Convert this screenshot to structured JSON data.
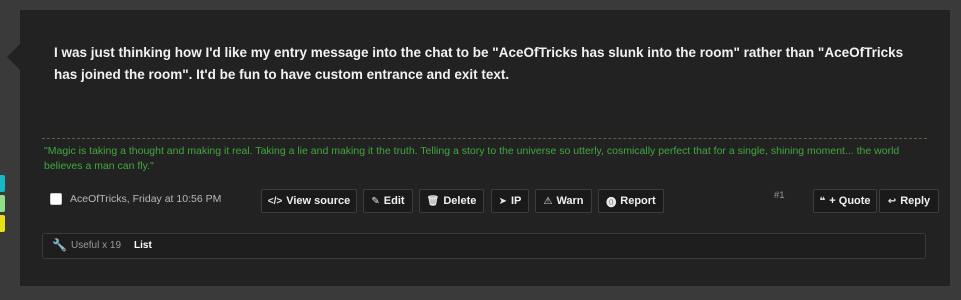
{
  "side_tabs": [
    {
      "color": "#17b7c4"
    },
    {
      "color": "#8fde8a"
    },
    {
      "color": "#e6df1a"
    }
  ],
  "post": {
    "message": "I was just thinking how I'd like my entry message into the chat to be \"AceOfTricks has slunk into the room\" rather than \"AceOfTricks has joined the room\". It'd be fun to have custom entrance and exit text.",
    "signature": "\"Magic is taking a thought and making it real. Taking a lie and making it the truth. Telling a story to the universe so utterly, cosmically perfect that for a single, shining moment... the world believes a man can fly.\"",
    "author": "AceOfTricks",
    "timestamp": "Friday at 10:56 PM",
    "post_number": "#1"
  },
  "actions": {
    "view_source": {
      "label": "View source",
      "icon": "</>"
    },
    "edit": {
      "label": "Edit",
      "icon": "✎"
    },
    "delete": {
      "label": "Delete",
      "icon": "🗑"
    },
    "ip": {
      "label": "IP",
      "icon": "➤"
    },
    "warn": {
      "label": "Warn",
      "icon": "⚠"
    },
    "report": {
      "label": "Report",
      "icon": "⓿"
    },
    "quote": {
      "label": "+ Quote",
      "icon": "❝"
    },
    "reply": {
      "label": "Reply",
      "icon": "↩"
    }
  },
  "likes": {
    "useful_label": "Useful x",
    "useful_count": "19",
    "list_label": "List"
  }
}
